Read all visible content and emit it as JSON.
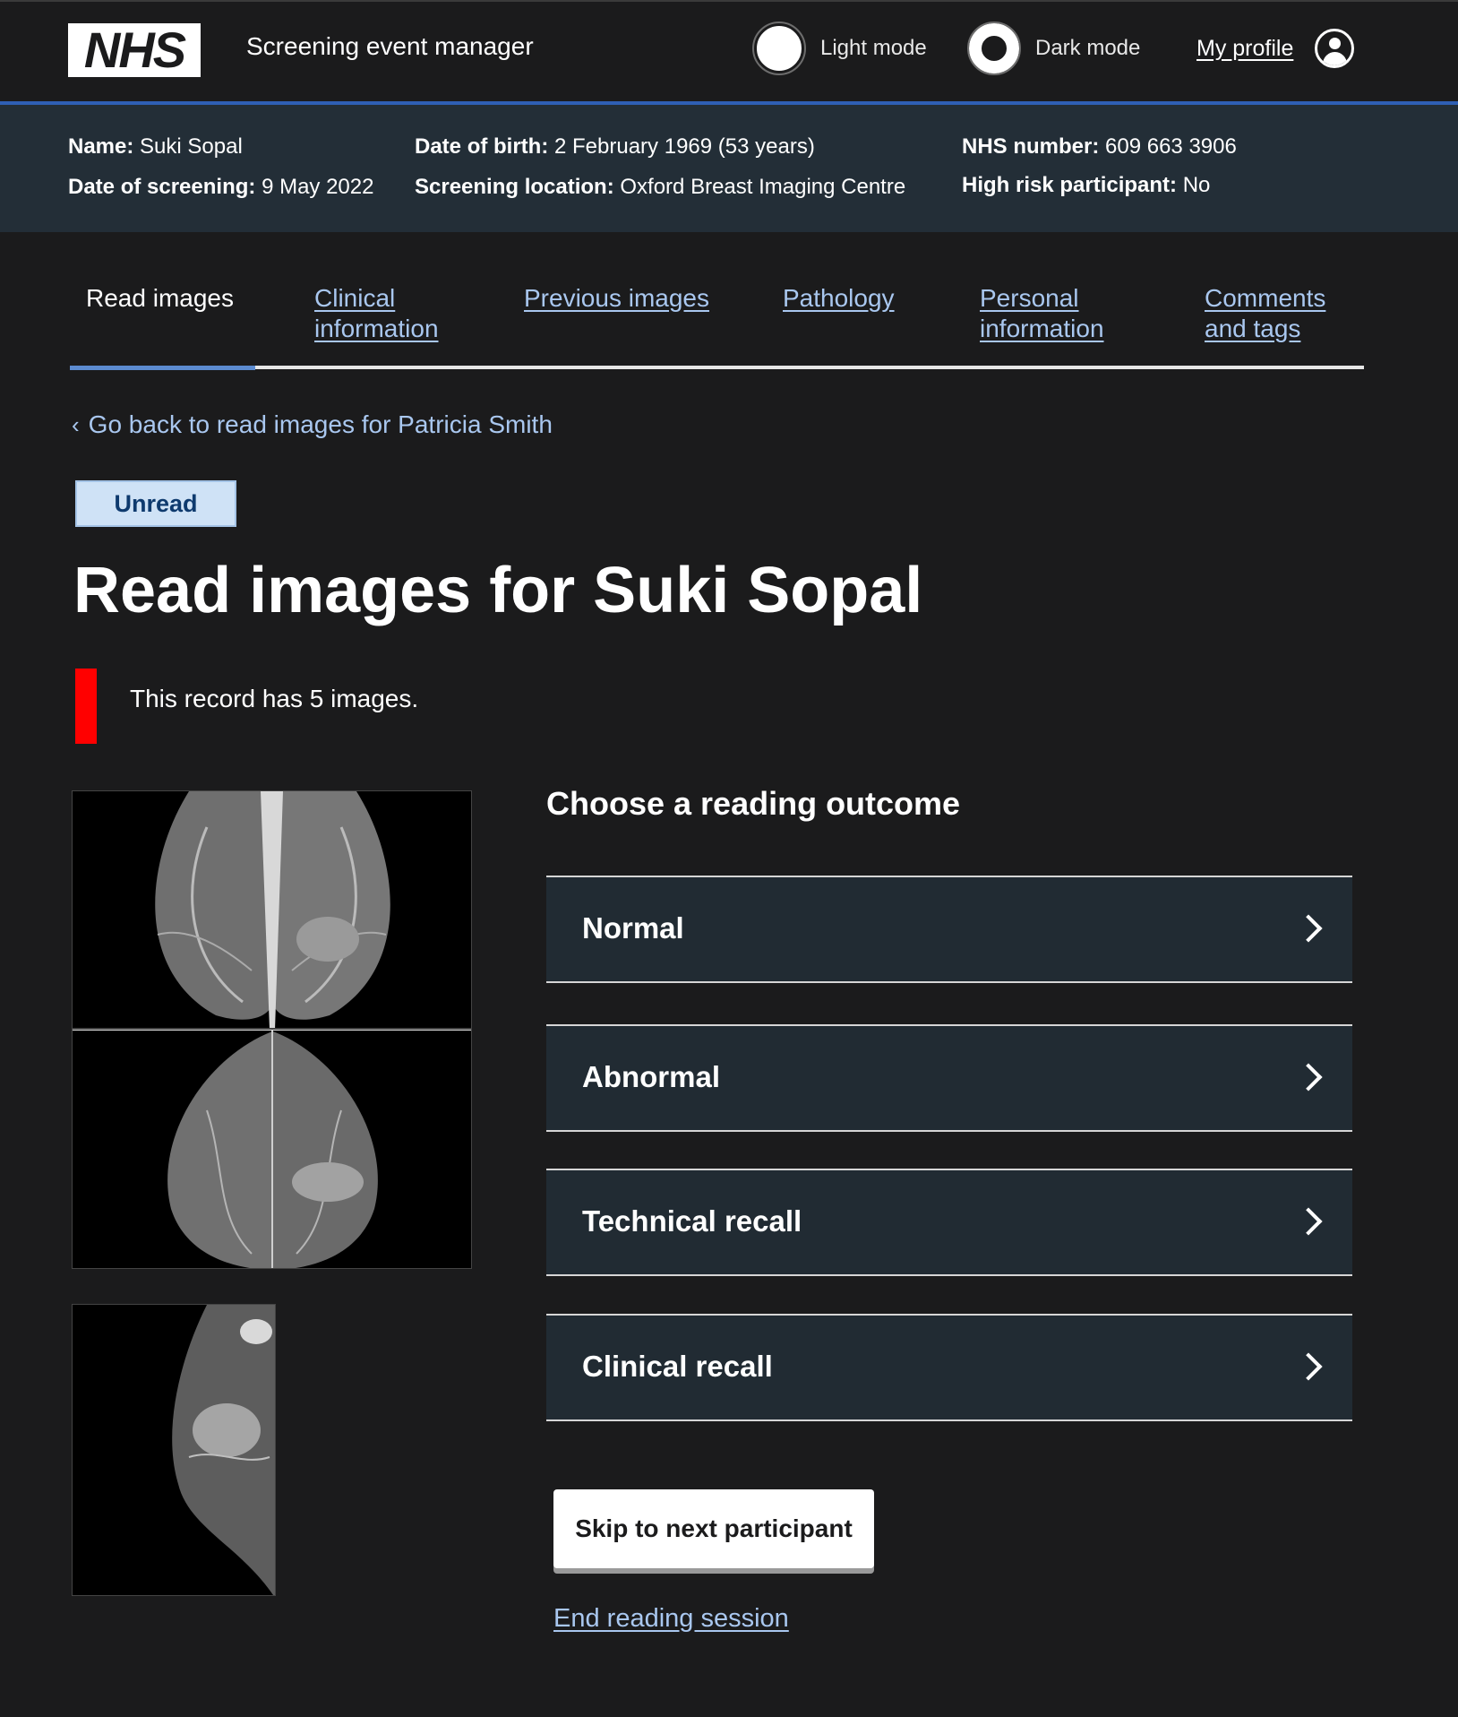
{
  "header": {
    "logo": "NHS",
    "service_name": "Screening event manager",
    "light_mode_label": "Light mode",
    "dark_mode_label": "Dark mode",
    "profile_label": "My profile"
  },
  "participant": {
    "name_label": "Name:",
    "name_value": "Suki Sopal",
    "screening_date_label": "Date of screening:",
    "screening_date_value": "9 May 2022",
    "dob_label": "Date of birth:",
    "dob_value": "2 February 1969 (53 years)",
    "location_label": "Screening location:",
    "location_value": "Oxford Breast Imaging Centre",
    "nhs_number_label": "NHS number:",
    "nhs_number_value": "609 663 3906",
    "high_risk_label": "High risk participant:",
    "high_risk_value": "No"
  },
  "tabs": [
    {
      "line1": "Read images",
      "line2": ""
    },
    {
      "line1": "Clinical",
      "line2": "information"
    },
    {
      "line1": "Previous images",
      "line2": ""
    },
    {
      "line1": "Pathology",
      "line2": ""
    },
    {
      "line1": "Personal",
      "line2": "information"
    },
    {
      "line1": "Comments",
      "line2": "and tags"
    }
  ],
  "back_link": "Go back to read images for Patricia Smith",
  "status_tag": "Unread",
  "page_title": "Read images for Suki Sopal",
  "inset_text": "This record has 5 images.",
  "outcome_heading": "Choose a reading outcome",
  "outcomes": [
    "Normal",
    "Abnormal",
    "Technical recall",
    "Clinical recall"
  ],
  "skip_button": "Skip to next participant",
  "end_link": "End reading session",
  "colors": {
    "background": "#1b1b1c",
    "banner": "#232e37",
    "link": "#a9c7ef",
    "inset_border": "#ff0000",
    "tag_bg": "#cfe2f6",
    "header_rule": "#2e5fb4"
  },
  "icons": {
    "back": "chevron-left-icon",
    "outcome": "chevron-right-icon",
    "profile": "user-circle-icon"
  }
}
